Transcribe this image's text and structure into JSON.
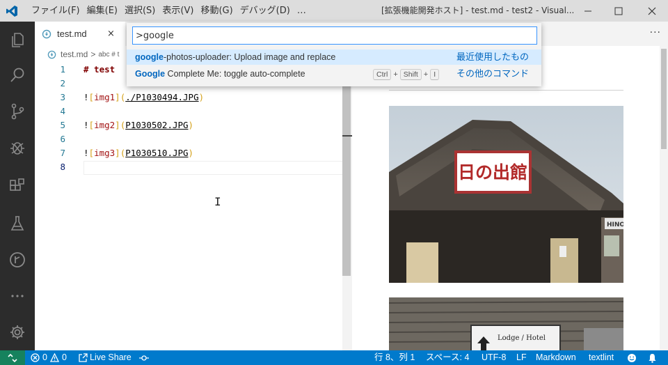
{
  "titlebar": {
    "menu": [
      "ファイル(F)",
      "編集(E)",
      "選択(S)",
      "表示(V)",
      "移動(G)",
      "デバッグ(D)",
      "…"
    ],
    "window_title": "[拡張機能開発ホスト] - test.md - test2 - Visual..."
  },
  "activity_bar": {
    "icons": [
      "explorer-icon",
      "search-icon",
      "source-control-icon",
      "debug-icon",
      "extensions-icon",
      "test-flask-icon",
      "git-graph-icon",
      "more-icon",
      "settings-gear-icon"
    ]
  },
  "tab": {
    "label": "test.md",
    "close": "×"
  },
  "breadcrumb": {
    "file": "test.md",
    "separator": ">",
    "symbol": "abc # t"
  },
  "editor": {
    "lines": [
      {
        "num": "1",
        "parts": [
          {
            "t": "# test",
            "c": "heading"
          }
        ]
      },
      {
        "num": "2",
        "parts": []
      },
      {
        "num": "3",
        "parts": [
          {
            "t": "!",
            "c": ""
          },
          {
            "t": "[",
            "c": "bracket"
          },
          {
            "t": "img1",
            "c": "alt"
          },
          {
            "t": "](",
            "c": "bracket"
          },
          {
            "t": "./P1030494.JPG",
            "c": "url"
          },
          {
            "t": ")",
            "c": "bracket"
          }
        ]
      },
      {
        "num": "4",
        "parts": []
      },
      {
        "num": "5",
        "parts": [
          {
            "t": "!",
            "c": ""
          },
          {
            "t": "[",
            "c": "bracket"
          },
          {
            "t": "img2",
            "c": "alt"
          },
          {
            "t": "](",
            "c": "bracket"
          },
          {
            "t": "P1030502.JPG",
            "c": "url"
          },
          {
            "t": ")",
            "c": "bracket"
          }
        ]
      },
      {
        "num": "6",
        "parts": []
      },
      {
        "num": "7",
        "parts": [
          {
            "t": "!",
            "c": ""
          },
          {
            "t": "[",
            "c": "bracket"
          },
          {
            "t": "img3",
            "c": "alt"
          },
          {
            "t": "](",
            "c": "bracket"
          },
          {
            "t": "P1030510.JPG",
            "c": "url"
          },
          {
            "t": ")",
            "c": "bracket"
          }
        ]
      },
      {
        "num": "8",
        "parts": [],
        "active": true
      }
    ]
  },
  "command_palette": {
    "input_value": ">google",
    "items": [
      {
        "match": "google",
        "rest": "-photos-uploader: Upload image and replace",
        "category": "最近使用したもの",
        "selected": true
      },
      {
        "match": "Google",
        "rest": " Complete Me: toggle auto-complete",
        "keys": [
          "Ctrl",
          "Shift",
          "I"
        ],
        "category": "その他のコマンド"
      }
    ]
  },
  "preview": {
    "photo1_sign": "日の出館",
    "photo1_side_sign": "HINOD",
    "photo2_sign": "Lodge / Hotel"
  },
  "statusbar": {
    "errors": "0",
    "warnings": "0",
    "live_share": "Live Share",
    "position": "行 8、列 1",
    "spaces": "スペース: 4",
    "encoding": "UTF-8",
    "eol": "LF",
    "language": "Markdown",
    "linter": "textlint"
  },
  "colors": {
    "accent": "#007acc",
    "remote": "#16825d",
    "activity_bar": "#2c2c2c",
    "match_highlight": "#0066bf",
    "selected_row": "#d6ebff"
  }
}
